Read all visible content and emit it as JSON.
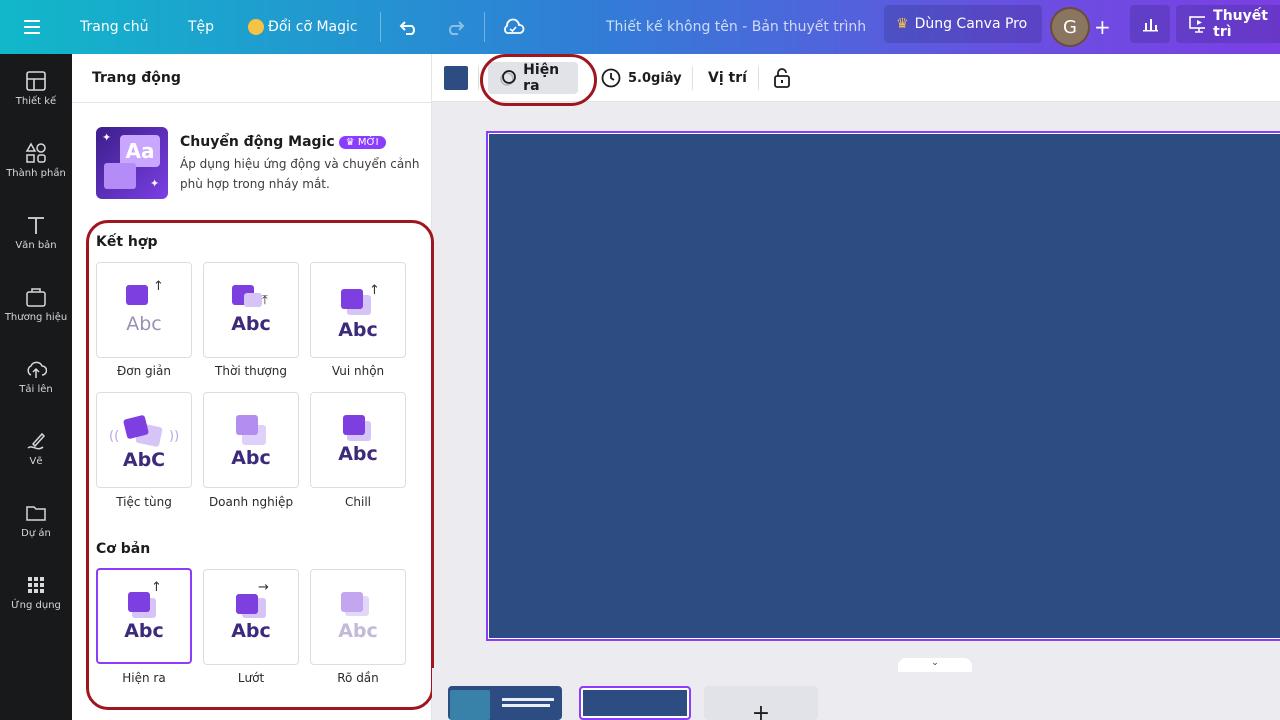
{
  "topbar": {
    "home": "Trang chủ",
    "file": "Tệp",
    "resize": "Đổi cỡ Magic",
    "title": "Thiết kế không tên - Bản thuyết trình",
    "pro": "Dùng Canva Pro",
    "avatar": "G",
    "present": "Thuyết trì"
  },
  "sidebar": {
    "items": [
      {
        "label": "Thiết kế",
        "icon": "layout-icon"
      },
      {
        "label": "Thành phần",
        "icon": "shapes-icon"
      },
      {
        "label": "Văn bản",
        "icon": "text-icon"
      },
      {
        "label": "Thương hiệu",
        "icon": "brand-icon"
      },
      {
        "label": "Tải lên",
        "icon": "upload-icon"
      },
      {
        "label": "Vẽ",
        "icon": "draw-icon"
      },
      {
        "label": "Dự án",
        "icon": "folder-icon"
      },
      {
        "label": "Ứng dụng",
        "icon": "apps-icon"
      }
    ]
  },
  "panel": {
    "heading": "Trang động",
    "magic_title": "Chuyển động Magic",
    "magic_badge": "MỚI",
    "magic_desc": "Áp dụng hiệu ứng động và chuyển cảnh phù hợp trong nháy mắt.",
    "section_combo": "Kết hợp",
    "combo": [
      "Đơn giản",
      "Thời thượng",
      "Vui nhộn",
      "Tiệc tùng",
      "Doanh nghiệp",
      "Chill"
    ],
    "section_basic": "Cơ bản",
    "basic": [
      "Hiện ra",
      "Lướt",
      "Rõ dần"
    ],
    "thumb_text": "Abc",
    "thumb_text_party": "AbC",
    "magic_thumb_text": "Aa"
  },
  "toolbar": {
    "color": "#2d4c82",
    "animate": "Hiện ra",
    "duration": "5.0giây",
    "position": "Vị trí"
  },
  "colors": {
    "accent": "#8b3dff",
    "highlight": "#a0161f",
    "canvas": "#2d4c82"
  }
}
